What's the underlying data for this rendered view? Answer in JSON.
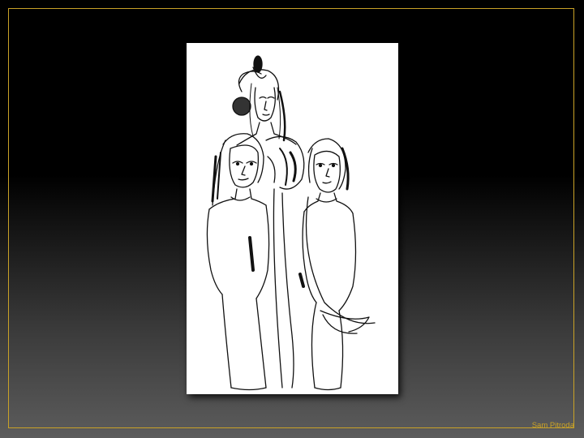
{
  "slide": {
    "credit": "Sam Pitroda",
    "accent_color": "#c9a227",
    "artwork": {
      "subject": "line-drawing",
      "figures": 3
    }
  }
}
